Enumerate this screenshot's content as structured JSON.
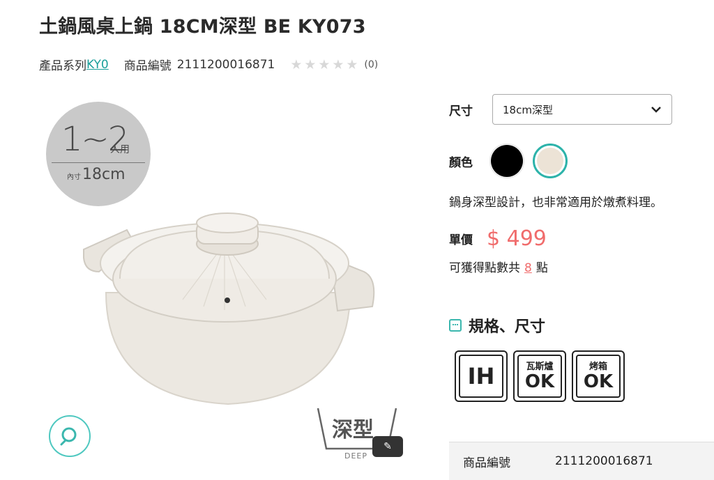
{
  "product": {
    "title": "土鍋風桌上鍋 18CM深型 BE KY073",
    "series_label": "產品系列",
    "series_value": "KY0",
    "sku_label": "商品編號",
    "sku_value": "2111200016871",
    "rating_stars": 0,
    "review_count": "(0)"
  },
  "gallery": {
    "badge_people": "1~2",
    "badge_people_unit": "人用",
    "badge_size_prefix": "內寸",
    "badge_size": "18cm",
    "deep_label": "深型",
    "deep_en": "DEEP",
    "zoom_icon": "search-icon",
    "edit_icon": "pencil-icon"
  },
  "options": {
    "size_label": "尺寸",
    "size_selected": "18cm深型",
    "color_label": "顏色",
    "colors": [
      {
        "name": "black",
        "hex": "#000000",
        "selected": false
      },
      {
        "name": "beige",
        "hex": "#ece3d6",
        "selected": true
      }
    ],
    "accent_color": "#2db3aa"
  },
  "description": "鍋身深型設計，也非常適用於燉煮料理。",
  "pricing": {
    "price_label": "單價",
    "price": "$ 499",
    "price_color": "#f06c6c",
    "points_prefix": "可獲得點數共",
    "points_value": "8",
    "points_suffix": "點"
  },
  "specs": {
    "heading": "規格、尺寸",
    "badges": [
      {
        "top": "",
        "main": "IH"
      },
      {
        "top": "瓦斯爐",
        "main": "OK"
      },
      {
        "top": "烤箱",
        "main": "OK"
      }
    ],
    "table": [
      {
        "key": "商品編號",
        "value": "2111200016871"
      }
    ]
  }
}
